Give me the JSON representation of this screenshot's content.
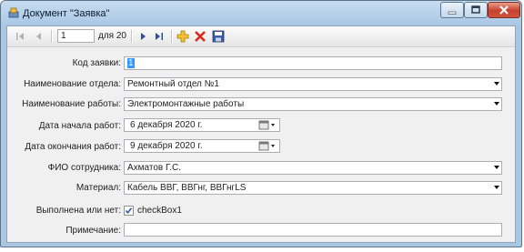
{
  "window": {
    "title": "Документ \"Заявка\"",
    "icons": {
      "app": "app-icon",
      "minimize": "minimize-icon",
      "maximize": "maximize-icon",
      "close": "close-icon"
    },
    "close_color": "#c6402a"
  },
  "toolbar": {
    "position": "1",
    "count_label": "для 20",
    "icons": [
      "move-first-icon",
      "move-previous-icon",
      "move-next-icon",
      "move-last-icon",
      "add-new-icon",
      "delete-icon",
      "save-icon"
    ],
    "delete_color": "#e0281a",
    "add_color": "#e8a000"
  },
  "form": {
    "request_code": {
      "label": "Код заявки:",
      "value": "1"
    },
    "department": {
      "label": "Наименование отдела:",
      "value": "Ремонтный отдел №1"
    },
    "work_name": {
      "label": "Наименование работы:",
      "value": "Электромонтажные работы"
    },
    "start_date": {
      "label": "Дата начала работ:",
      "value": "6 декабря  2020 г."
    },
    "end_date": {
      "label": "Дата окончания работ:",
      "value": "9 декабря  2020 г."
    },
    "employee": {
      "label": "ФИО сотрудника:",
      "value": "Ахматов Г.С."
    },
    "material": {
      "label": "Материал:",
      "value": "Кабель ВВГ, ВВГнг, ВВГнгLS"
    },
    "completed": {
      "label": "Выполнена или нет:",
      "checked": true,
      "check_label": "checkBox1"
    },
    "note": {
      "label": "Примечание:",
      "value": ""
    }
  }
}
